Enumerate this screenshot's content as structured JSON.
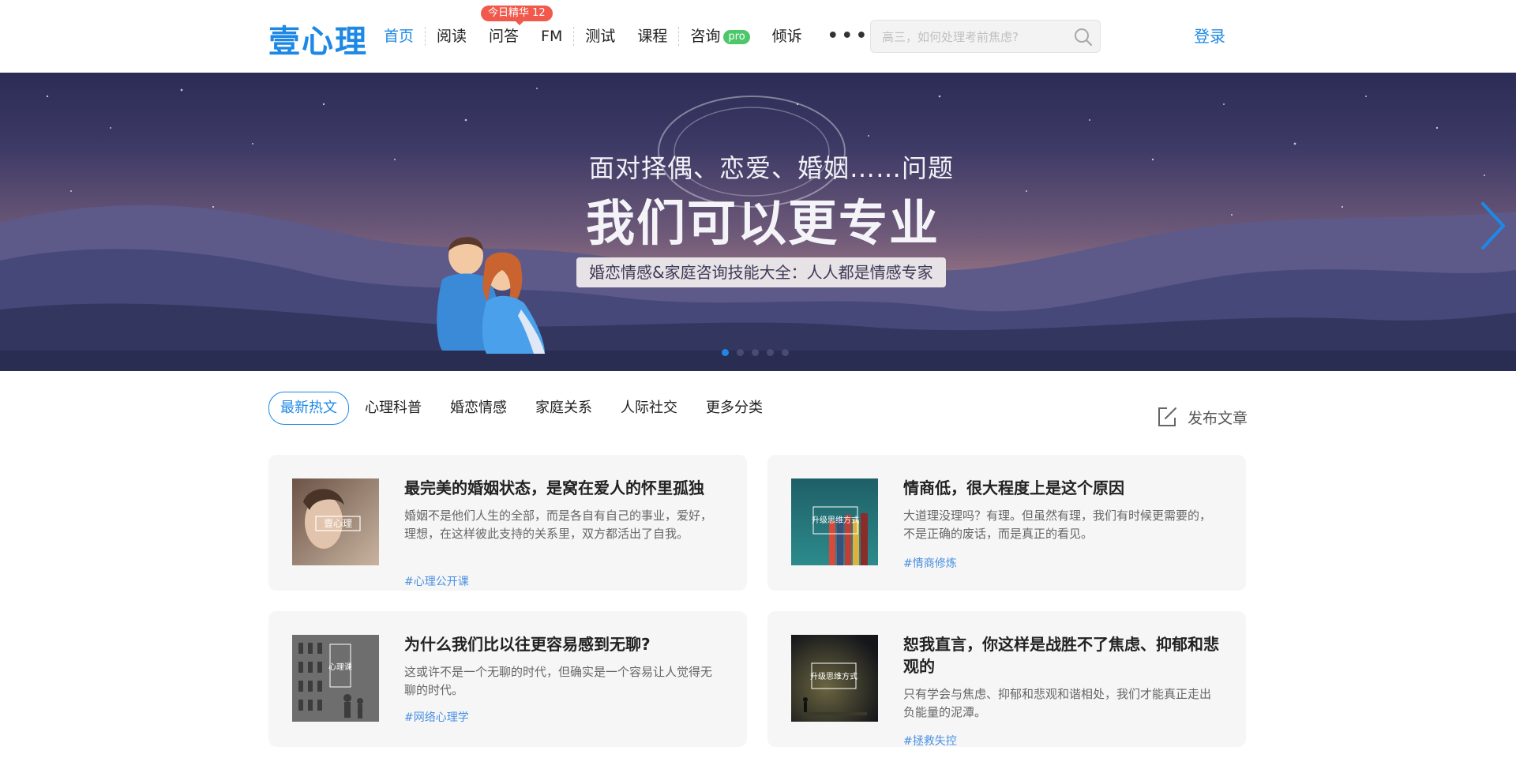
{
  "header": {
    "logo": "壹心理",
    "nav": [
      {
        "label": "首页",
        "active": true
      },
      {
        "label": "阅读"
      },
      {
        "label": "问答",
        "badge": "今日精华 12"
      },
      {
        "label": "FM"
      },
      {
        "label": "测试"
      },
      {
        "label": "课程"
      },
      {
        "label": "咨询",
        "badge": "pro"
      },
      {
        "label": "倾诉"
      }
    ],
    "more": "•••",
    "search_placeholder": "高三，如何处理考前焦虑?",
    "login": "登录"
  },
  "banner": {
    "line1": "面对择偶、恋爱、婚姻……问题",
    "line2": "我们可以更专业",
    "pill": "婚恋情感&家庭咨询技能大全：人人都是情感专家",
    "slide_count": 5,
    "active_slide": 1
  },
  "tabs": [
    "最新热文",
    "心理科普",
    "婚恋情感",
    "家庭关系",
    "人际社交",
    "更多分类"
  ],
  "publish_label": "发布文章",
  "articles": [
    {
      "title": "最完美的婚姻状态，是窝在爱人的怀里孤独",
      "desc": "婚姻不是他们人生的全部，而是各自有自己的事业，爱好，理想，在这样彼此支持的关系里，双方都活出了自我。",
      "tag": "#心理公开课",
      "thumb_text": "壹心理"
    },
    {
      "title": "情商低，很大程度上是这个原因",
      "desc": "大道理没理吗？有理。但虽然有理，我们有时候更需要的，不是正确的废话，而是真正的看见。",
      "tag": "#情商修炼",
      "thumb_text": "升级思维方式"
    },
    {
      "title": "为什么我们比以往更容易感到无聊?",
      "desc": "这或许不是一个无聊的时代，但确实是一个容易让人觉得无聊的时代。",
      "tag": "#网络心理学",
      "thumb_text": "心理课"
    },
    {
      "title": "恕我直言，你这样是战胜不了焦虑、抑郁和悲观的",
      "desc": "只有学会与焦虑、抑郁和悲观和谐相处，我们才能真正走出负能量的泥潭。",
      "tag": "#拯救失控",
      "thumb_text": "升级思维方式"
    }
  ],
  "colors": {
    "brand": "#1e88e5",
    "badge_red": "#f0594c",
    "badge_green": "#4cc76a",
    "tag": "#4a90e2"
  }
}
